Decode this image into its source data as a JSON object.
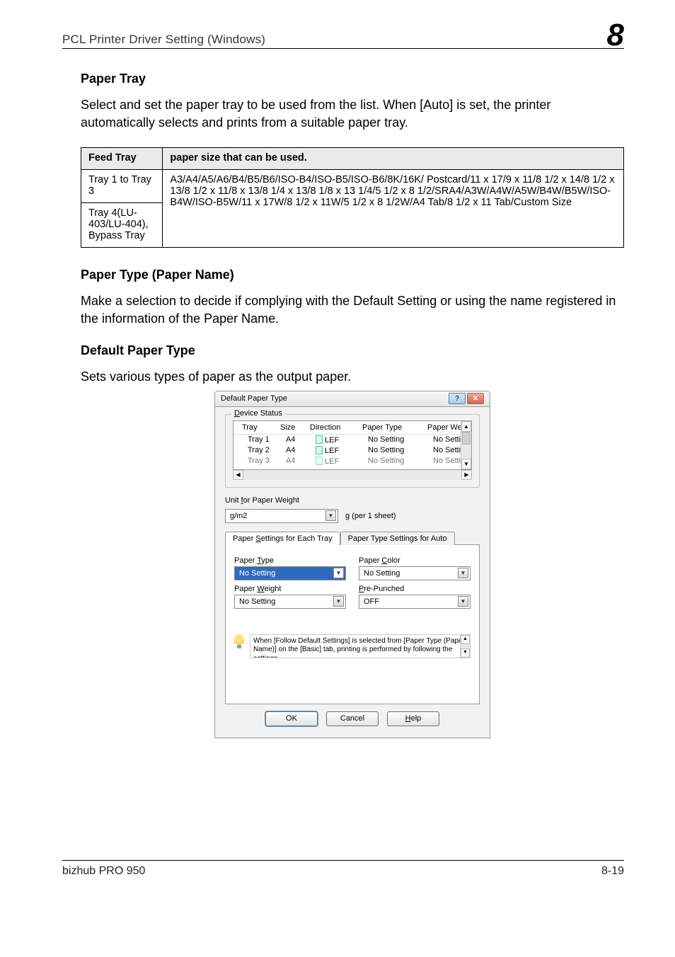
{
  "header": {
    "left": "PCL Printer Driver Setting (Windows)",
    "right": "8"
  },
  "sections": {
    "paper_tray": {
      "heading": "Paper Tray",
      "body": "Select and set the paper tray to be used from the list. When [Auto] is set, the printer automatically selects and prints from a suitable paper tray."
    },
    "paper_type": {
      "heading": "Paper Type (Paper Name)",
      "body": "Make a selection to decide if complying with the Default Setting or using the name registered in the information of the Paper Name."
    },
    "default_paper_type": {
      "heading": "Default Paper Type",
      "body": "Sets various types of paper as the output paper."
    }
  },
  "table": {
    "headers": [
      "Feed Tray",
      "paper size that can be used."
    ],
    "rows": [
      {
        "c0": "Tray 1 to Tray 3",
        "c1": "A3/A4/A5/A6/B4/B5/B6/ISO-B4/ISO-B5/ISO-B6/8K/16K/"
      },
      {
        "c0": "Tray 4(LU-403/LU-404), Bypass Tray",
        "c1": "Postcard/11 x 17/9 x 11/8 1/2 x 14/8 1/2 x 13/8 1/2 x 11/8 x 13/8 1/4 x 13/8 1/8 x 13 1/4/5 1/2 x 8 1/2/SRA4/A3W/A4W/A5W/B4W/B5W/ISO-B4W/ISO-B5W/11 x 17W/8 1/2 x 11W/5 1/2 x 8 1/2W/A4 Tab/8 1/2 x 11 Tab/Custom Size"
      }
    ]
  },
  "dialog": {
    "title": "Default Paper Type",
    "device_status": {
      "group_label": "Device Status",
      "columns": [
        "Tray",
        "Size",
        "Direction",
        "Paper Type",
        "Paper Weight"
      ],
      "rows": [
        {
          "tray": "Tray 1",
          "size": "A4",
          "dir": "LEF",
          "ptype": "No Setting",
          "pweight": "No Setting"
        },
        {
          "tray": "Tray 2",
          "size": "A4",
          "dir": "LEF",
          "ptype": "No Setting",
          "pweight": "No Setting"
        },
        {
          "tray": "Tray 3",
          "size": "A4",
          "dir": "LEF",
          "ptype": "No Setting",
          "pweight": "No Setting"
        }
      ]
    },
    "unit_label": "Unit for Paper Weight",
    "unit_value": "g/m2",
    "unit_suffix": "g (per 1 sheet)",
    "tabs": {
      "active": "Paper Settings for Each Tray",
      "inactive": "Paper Type Settings for Auto"
    },
    "fields": {
      "paper_type_label": "Paper Type",
      "paper_type_value": "No Setting",
      "paper_color_label": "Paper Color",
      "paper_color_value": "No Setting",
      "paper_weight_label": "Paper Weight",
      "paper_weight_value": "No Setting",
      "pre_punched_label": "Pre-Punched",
      "pre_punched_value": "OFF"
    },
    "hint": "When [Follow Default Settings] is selected from [Paper Type (Paper Name)] on the [Basic] tab, printing is performed by following the settings",
    "buttons": {
      "ok": "OK",
      "cancel": "Cancel",
      "help": "Help"
    }
  },
  "footer": {
    "left": "bizhub PRO 950",
    "right": "8-19"
  }
}
